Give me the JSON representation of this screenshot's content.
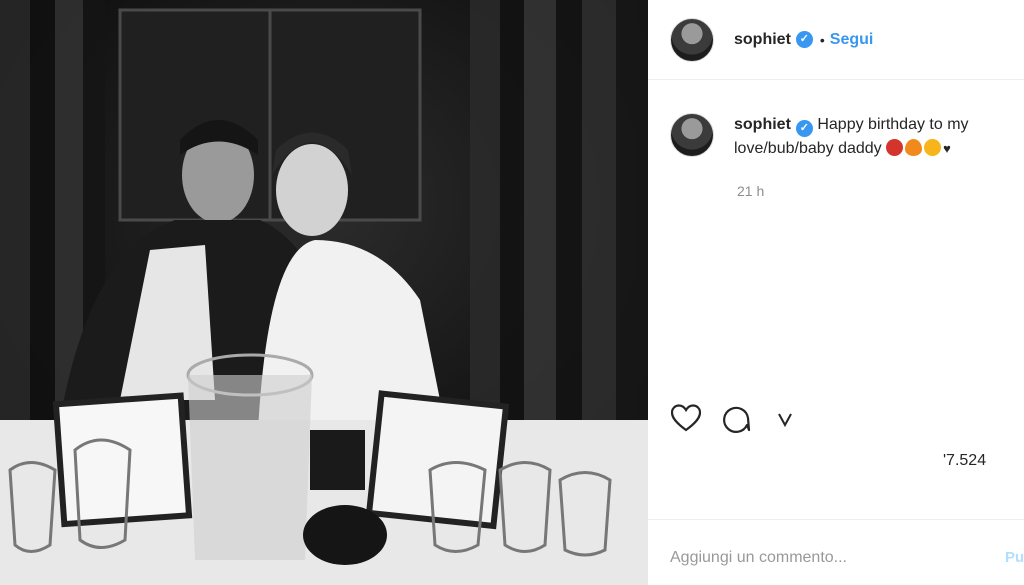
{
  "post": {
    "image_alt": "Black and white photo of a couple seated at a restaurant table",
    "username": "sophiet",
    "verified_glyph": "✓",
    "separator": "•",
    "follow_label": "Segui",
    "caption": {
      "username": "sophiet",
      "text": "Happy birthday to my love/bub/baby daddy",
      "emojis": [
        "angry-face",
        "fire",
        "star-struck"
      ],
      "trailing": "♥"
    },
    "time_ago": "21 h",
    "likes": "'7.524",
    "comment_placeholder": "Aggiungi un commento...",
    "publish_label": "Pu"
  },
  "icons": {
    "like": "heart-outline-icon",
    "comment": "comment-bubble-icon",
    "share": "share-icon"
  },
  "colors": {
    "accent": "#3897f0",
    "muted": "#8e8e8e",
    "text": "#262626"
  }
}
